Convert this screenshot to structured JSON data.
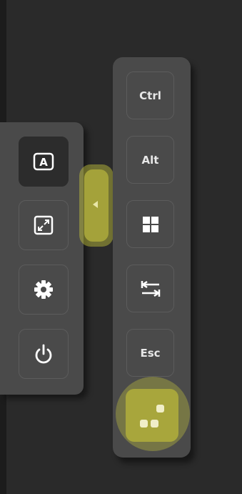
{
  "left_toolbar": {
    "items": [
      {
        "icon": "keyboard-a-icon",
        "glyph": "A",
        "active": true
      },
      {
        "icon": "fullscreen-icon",
        "active": false
      },
      {
        "icon": "gear-icon",
        "active": false
      },
      {
        "icon": "power-icon",
        "active": false
      }
    ]
  },
  "collapse_handle": {
    "icon": "chevron-left-icon"
  },
  "keys": {
    "ctrl": "Ctrl",
    "alt": "Alt",
    "win_icon": "windows-icon",
    "tab_icon": "tab-icon",
    "esc": "Esc"
  },
  "menu_button": {
    "icon": "dots-menu-icon"
  },
  "colors": {
    "background": "#2a2a2a",
    "panel": "#4a4a4a",
    "accent": "#a8a63c",
    "text": "#e8e8e8"
  }
}
